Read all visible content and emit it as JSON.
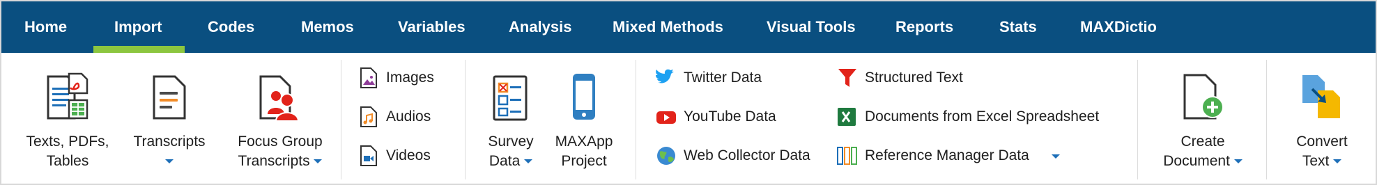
{
  "menu": {
    "tabs": [
      {
        "label": "Home"
      },
      {
        "label": "Import"
      },
      {
        "label": "Codes"
      },
      {
        "label": "Memos"
      },
      {
        "label": "Variables"
      },
      {
        "label": "Analysis"
      },
      {
        "label": "Mixed Methods"
      },
      {
        "label": "Visual Tools"
      },
      {
        "label": "Reports"
      },
      {
        "label": "Stats"
      },
      {
        "label": "MAXDictio"
      }
    ],
    "active_tab": "Import",
    "active_color": "#8cc63f",
    "bar_color": "#0a4f80"
  },
  "ribbon": {
    "texts": {
      "line1": "Texts, PDFs,",
      "line2": "Tables",
      "icon": "texts-pdf-table-icon"
    },
    "transcripts": {
      "line1": "Transcripts",
      "icon": "transcript-icon",
      "has_dropdown": true
    },
    "focus_group": {
      "line1": "Focus Group",
      "line2": "Transcripts",
      "icon": "focus-group-icon",
      "has_dropdown": true
    },
    "images": {
      "label": "Images",
      "icon": "image-file-icon"
    },
    "audios": {
      "label": "Audios",
      "icon": "audio-file-icon"
    },
    "videos": {
      "label": "Videos",
      "icon": "video-file-icon"
    },
    "survey": {
      "line1": "Survey",
      "line2": "Data",
      "icon": "survey-icon",
      "has_dropdown": true
    },
    "maxapp": {
      "line1": "MAXApp",
      "line2": "Project",
      "icon": "smartphone-icon"
    },
    "twitter": {
      "label": "Twitter Data",
      "icon": "twitter-icon"
    },
    "youtube": {
      "label": "YouTube Data",
      "icon": "youtube-icon"
    },
    "webcollector": {
      "label": "Web Collector Data",
      "icon": "globe-icon"
    },
    "structured": {
      "label": "Structured Text",
      "icon": "funnel-icon"
    },
    "excel": {
      "label": "Documents from Excel Spreadsheet",
      "icon": "excel-icon"
    },
    "refmanager": {
      "label": "Reference Manager Data",
      "icon": "reference-manager-icon",
      "has_dropdown": true
    },
    "create_doc": {
      "line1": "Create",
      "line2": "Document",
      "icon": "create-document-icon",
      "has_dropdown": true
    },
    "convert_text": {
      "line1": "Convert",
      "line2": "Text",
      "icon": "convert-text-icon",
      "has_dropdown": true
    }
  }
}
